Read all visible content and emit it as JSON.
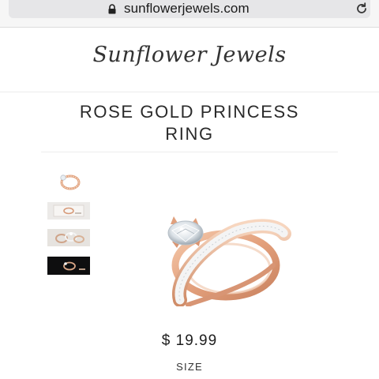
{
  "browser": {
    "url": "sunflowerjewels.com",
    "lock_icon": "lock-icon",
    "reload_icon": "reload-icon"
  },
  "site": {
    "logo_text": "Sunflower Jewels"
  },
  "product": {
    "title_line1": "ROSE GOLD PRINCESS",
    "title_line2": "RING",
    "price": "$ 19.99",
    "size_label": "SIZE"
  },
  "gallery": {
    "thumbnails": [
      {
        "name": "thumbnail-ring-closeup"
      },
      {
        "name": "thumbnail-ring-box"
      },
      {
        "name": "thumbnail-ring-stack"
      },
      {
        "name": "thumbnail-ring-dark"
      }
    ]
  },
  "colors": {
    "rose_gold": "#e8b08f",
    "rose_gold_dark": "#c98a68",
    "diamond": "#f2f4f6",
    "url_bar_bg": "#e6e6e8"
  }
}
